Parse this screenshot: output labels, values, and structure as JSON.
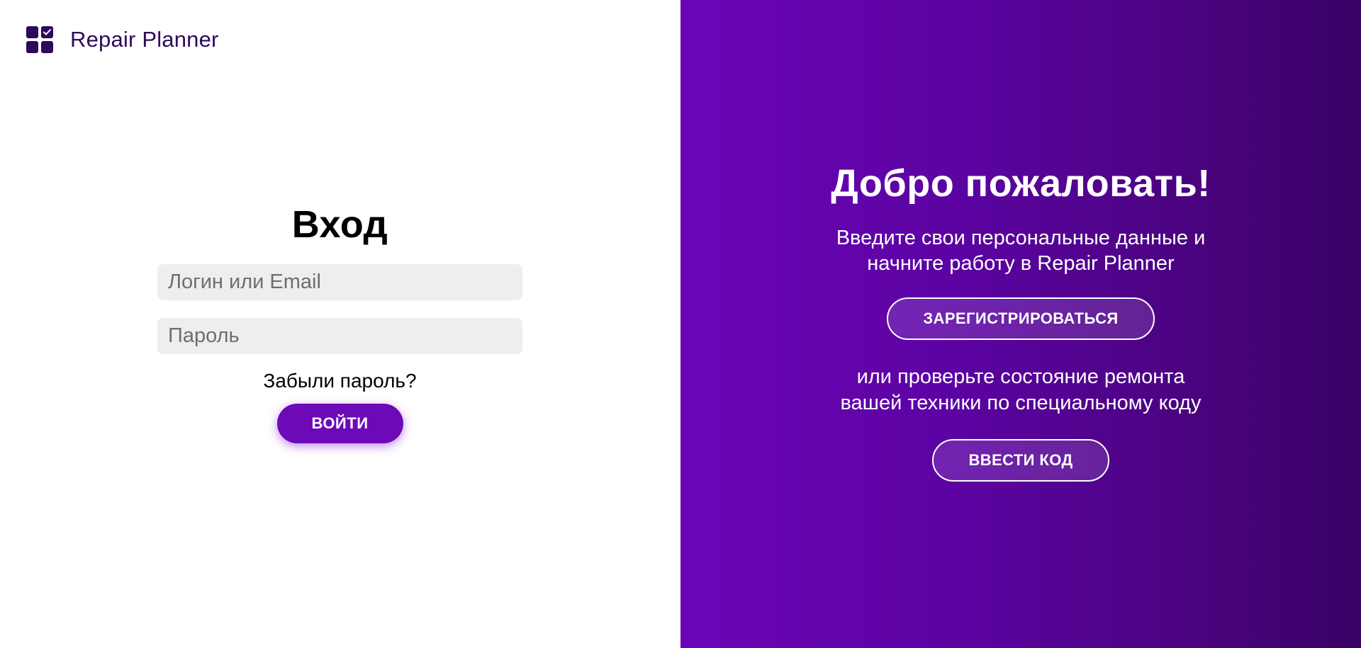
{
  "brand": {
    "logo_icon": "dashboard-grid-check-icon",
    "name": "Repair Planner"
  },
  "login": {
    "title": "Вход",
    "login_placeholder": "Логин или Email",
    "password_placeholder": "Пароль",
    "forgot_label": "Забыли пароль?",
    "submit_label": "ВОЙТИ"
  },
  "welcome": {
    "title": "Добро пожаловать!",
    "text": "Введите свои персональные данные и\nначните работу в Repair Planner",
    "register_label": "ЗАРЕГИСТРИРОВАТЬСЯ",
    "or_text": "или проверьте состояние ремонта\nвашей техники по специальному коду",
    "code_label": "ВВЕСТИ КОД"
  },
  "colors": {
    "brand": "#2e0a5c",
    "accent": "#6d0ab8",
    "gradient_start": "#6a05b6",
    "gradient_end": "#3a0266",
    "input_bg": "#eeeeee"
  }
}
